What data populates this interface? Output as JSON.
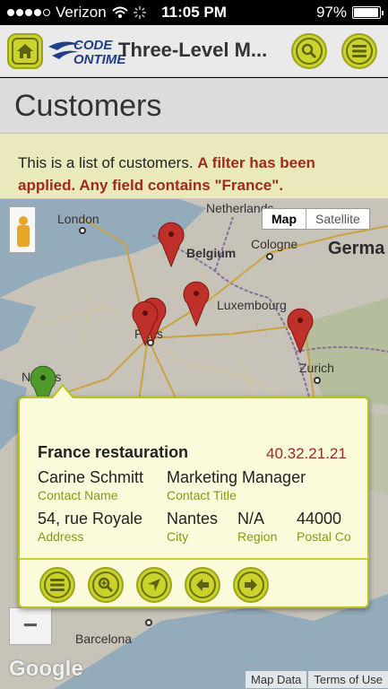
{
  "status_bar": {
    "carrier": "Verizon",
    "time": "11:05 PM",
    "battery": "97%",
    "battery_level": 0.97
  },
  "header": {
    "logo_code": "CODE",
    "logo_ontime": "ONTIME",
    "title": "Three-Level M..."
  },
  "page": {
    "title": "Customers"
  },
  "info": {
    "text": "This is a list of customers.",
    "filter_text": "A filter has been applied. Any field contains \"France\"."
  },
  "map": {
    "type_buttons": [
      "Map",
      "Satellite"
    ],
    "labels": {
      "london": "London",
      "netherlands": "Netherlands",
      "belgium": "Belgium",
      "cologne": "Cologne",
      "germany": "Germa",
      "luxembourg": "Luxembourg",
      "paris": "Paris",
      "nantes": "Nantes",
      "zurich": "Zurich",
      "barcelona": "Barcelona"
    },
    "zoom_out": "−",
    "google_logo": "Google",
    "footer": [
      "Map Data",
      "Terms of Use"
    ],
    "colors": {
      "pin_red": "#c0302b",
      "pin_green": "#4f9a2a"
    }
  },
  "popup": {
    "company": "France restauration",
    "phone": "40.32.21.21",
    "contact_name": "Carine Schmitt",
    "contact_name_label": "Contact Name",
    "contact_title": "Marketing Manager",
    "contact_title_label": "Contact Title",
    "address": "54, rue Royale",
    "address_label": "Address",
    "city": "Nantes",
    "city_label": "City",
    "region": "N/A",
    "region_label": "Region",
    "postal_code": "44000",
    "postal_code_label": "Postal Co"
  }
}
